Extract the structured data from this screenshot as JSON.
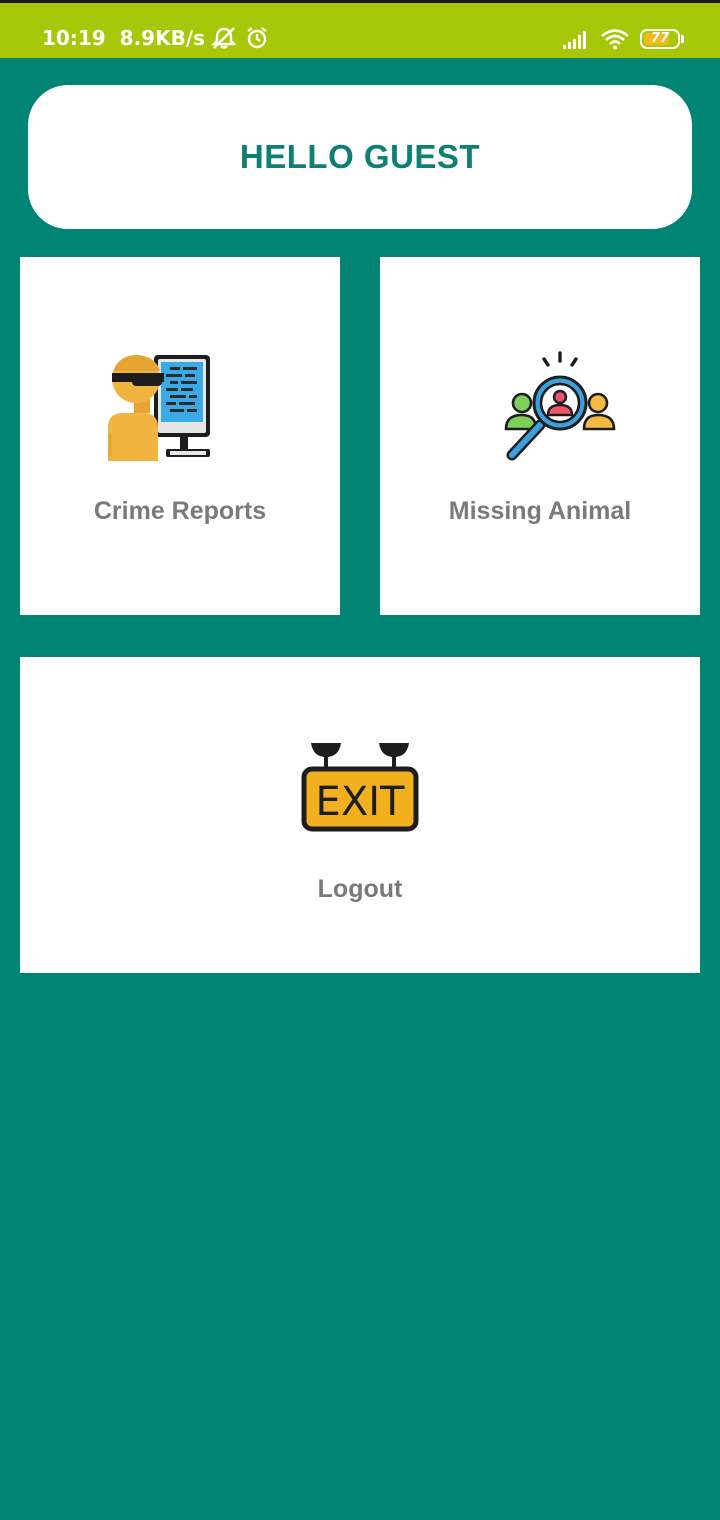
{
  "status_bar": {
    "time": "10:19",
    "network_speed": "8.9KB/s",
    "battery_level": "77",
    "icons": [
      "no-notifications-icon",
      "alarm-icon",
      "signal-icon",
      "wifi-icon",
      "battery-icon"
    ]
  },
  "header": {
    "greeting": "HELLO GUEST"
  },
  "menu": {
    "crime_reports": {
      "label": "Crime Reports",
      "icon": "crime-hacker-icon"
    },
    "missing_animal": {
      "label": "Missing Animal",
      "icon": "magnifier-search-people-icon"
    },
    "logout": {
      "label": "Logout",
      "icon": "exit-sign-icon"
    }
  },
  "colors": {
    "status_bar": "#a6c808",
    "background": "#008574",
    "card": "#ffffff",
    "greeting_text": "#0d7f73",
    "label_text": "#7a7a7a"
  }
}
